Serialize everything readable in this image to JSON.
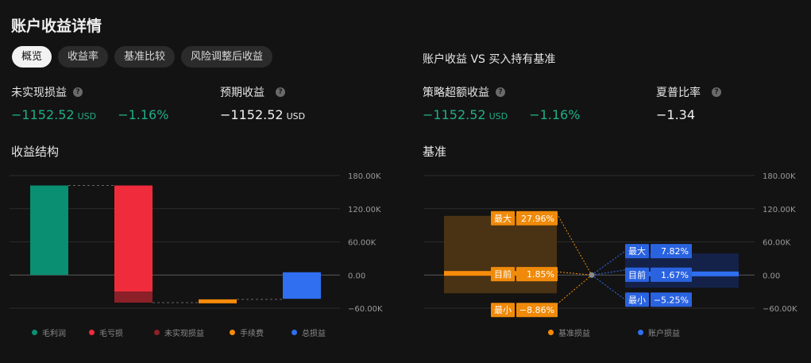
{
  "page": {
    "title": "账户收益详情"
  },
  "tabs": [
    {
      "label": "概览",
      "active": true
    },
    {
      "label": "收益率",
      "active": false
    },
    {
      "label": "基准比较",
      "active": false
    },
    {
      "label": "风险调整后收益",
      "active": false
    }
  ],
  "comparison_title": "账户收益 VS 买入持有基准",
  "metrics": {
    "unrealized": {
      "label": "未实现损益",
      "value": "−1152.52",
      "unit": "USD",
      "pct": "−1.16%"
    },
    "expected": {
      "label": "预期收益",
      "value": "−1152.52",
      "unit": "USD"
    },
    "excess": {
      "label": "策略超额收益",
      "value": "−1152.52",
      "unit": "USD",
      "pct": "−1.16%"
    },
    "sharpe": {
      "label": "夏普比率",
      "value": "−1.34"
    }
  },
  "colors": {
    "gross_profit": "#0a8f72",
    "gross_loss": "#f02c3c",
    "unrealized": "#8c2028",
    "fees": "#f78b0a",
    "total": "#2f6ff0",
    "positive_text": "#1fae86"
  },
  "chart_data": [
    {
      "type": "bar",
      "title": "收益结构",
      "y_ticks": [
        "180.00K",
        "120.00K",
        "60.00K",
        "0.00",
        "−60.00K"
      ],
      "ylim": [
        -60000,
        180000
      ],
      "bars": [
        {
          "name": "毛利润",
          "start": 0,
          "end": 162000,
          "color": "#0a8f72"
        },
        {
          "name": "毛亏损",
          "start": 162000,
          "end": -30000,
          "color": "#f02c3c"
        },
        {
          "name": "未实现损益",
          "start": -30000,
          "end": -50000,
          "color": "#8c2028"
        },
        {
          "name": "手续费",
          "start": -44000,
          "end": -50000,
          "color": "#f78b0a"
        },
        {
          "name": "总损益",
          "start": 5000,
          "end": -43000,
          "color": "#2f6ff0"
        }
      ],
      "legend": [
        {
          "label": "毛利润",
          "color": "#0a8f72"
        },
        {
          "label": "毛亏损",
          "color": "#f02c3c"
        },
        {
          "label": "未实现损益",
          "color": "#8c2028"
        },
        {
          "label": "手续费",
          "color": "#f78b0a"
        },
        {
          "label": "总损益",
          "color": "#2f6ff0"
        }
      ]
    },
    {
      "type": "range",
      "title": "基准",
      "y_ticks": [
        "180.00K",
        "120.00K",
        "60.00K",
        "0.00",
        "−60.00K"
      ],
      "ylim": [
        -60000,
        180000
      ],
      "benchmark": {
        "name": "基准损益",
        "color": "#f78b0a",
        "max_value": 107000,
        "current_value": 3000,
        "min_value": -33000,
        "max_label": "最大",
        "max_pct": "27.96%",
        "cur_label": "目前",
        "cur_pct": "1.85%",
        "min_label": "最小",
        "min_pct": "−8.86%"
      },
      "account": {
        "name": "账户损益",
        "color": "#2f6ff0",
        "max_value": 39000,
        "current_value": 2000,
        "min_value": -23000,
        "max_label": "最大",
        "max_pct": "7.82%",
        "cur_label": "目前",
        "cur_pct": "1.67%",
        "min_label": "最小",
        "min_pct": "−5.25%"
      },
      "legend": [
        {
          "label": "基准损益",
          "color": "#f78b0a"
        },
        {
          "label": "账户损益",
          "color": "#2f6ff0"
        }
      ]
    }
  ]
}
